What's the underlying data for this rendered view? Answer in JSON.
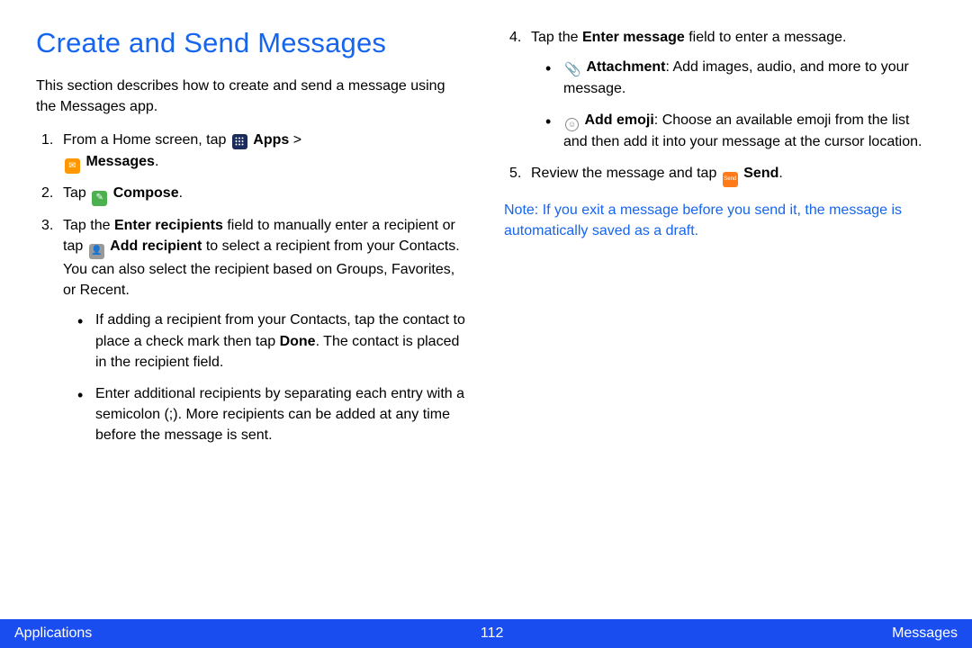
{
  "title": "Create and Send Messages",
  "intro": "This section describes how to create and send a message using the Messages app.",
  "left": {
    "step1_a": "From a Home screen, tap ",
    "step1_apps": "Apps",
    "step1_b": " > ",
    "step1_msg": "Messages",
    "step1_c": ".",
    "step2_a": "Tap ",
    "step2_compose": "Compose",
    "step2_b": ".",
    "step3_a": "Tap the ",
    "step3_b": "Enter recipients",
    "step3_c": " field to manually enter a recipient or tap ",
    "step3_d": "Add recipient",
    "step3_e": " to select a recipient from your Contacts. You can also select the recipient based on Groups, Favorites, or Recent.",
    "bullet1_a": "If adding a recipient from your Contacts, tap the contact to place a check mark then tap ",
    "bullet1_b": "Done",
    "bullet1_c": ". The contact is placed in the recipient field.",
    "bullet2": "Enter additional recipients by separating each entry with a semicolon (;). More recipients can be added at any time before the message is sent."
  },
  "right": {
    "step4_a": "Tap the ",
    "step4_b": "Enter message",
    "step4_c": " field to enter a message.",
    "bullet_att_a": "Attachment",
    "bullet_att_b": ": Add images, audio, and more to your message.",
    "bullet_emo_a": "Add emoji",
    "bullet_emo_b": ": Choose an available emoji from the list and then add it into your message at the cursor location.",
    "step5_a": "Review the message and tap ",
    "step5_b": "Send",
    "step5_c": ".",
    "note_a": "Note",
    "note_b": ": If you exit a message before you send it, the message is automatically saved as a draft."
  },
  "footer": {
    "left": "Applications",
    "center": "112",
    "right": "Messages"
  }
}
